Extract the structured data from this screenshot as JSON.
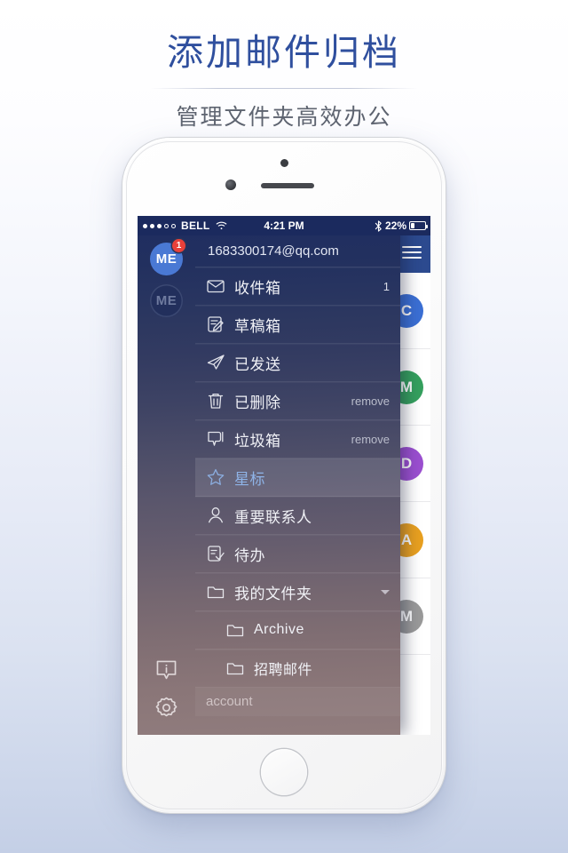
{
  "promo": {
    "title": "添加邮件归档",
    "subtitle": "管理文件夹高效办公"
  },
  "statusbar": {
    "carrier": "BELL",
    "wifi_icon": "wifi-icon",
    "time": "4:21 PM",
    "bluetooth_icon": "bluetooth-icon",
    "battery_percent": "22%",
    "battery_icon": "battery-icon",
    "signal_dots_filled": 3,
    "signal_dots_total": 5
  },
  "navbar": {
    "menu_icon": "hamburger-icon"
  },
  "rail": {
    "accounts": [
      {
        "initials": "ME",
        "badge": "1",
        "state": "active"
      },
      {
        "initials": "ME",
        "badge": "",
        "state": "inactive"
      }
    ],
    "bottom_icons": [
      {
        "name": "info-icon"
      },
      {
        "name": "gear-icon"
      }
    ]
  },
  "drawer": {
    "account_email": "1683300174@qq.com",
    "items": [
      {
        "label": "收件箱",
        "icon": "envelope-icon",
        "meta": "1",
        "meta_type": "count",
        "state": "normal"
      },
      {
        "label": "草稿箱",
        "icon": "draft-icon",
        "meta": "",
        "meta_type": "",
        "state": "normal"
      },
      {
        "label": "已发送",
        "icon": "send-icon",
        "meta": "",
        "meta_type": "",
        "state": "normal"
      },
      {
        "label": "已删除",
        "icon": "trash-icon",
        "meta": "remove",
        "meta_type": "action",
        "state": "normal"
      },
      {
        "label": "垃圾箱",
        "icon": "spam-icon",
        "meta": "remove",
        "meta_type": "action",
        "state": "normal"
      },
      {
        "label": "星标",
        "icon": "star-icon",
        "meta": "",
        "meta_type": "",
        "state": "selected"
      },
      {
        "label": "重要联系人",
        "icon": "person-icon",
        "meta": "",
        "meta_type": "",
        "state": "normal"
      },
      {
        "label": "待办",
        "icon": "todo-icon",
        "meta": "",
        "meta_type": "",
        "state": "normal"
      },
      {
        "label": "我的文件夹",
        "icon": "folder-icon",
        "meta": "",
        "meta_type": "chevron",
        "state": "normal"
      }
    ],
    "subfolders": [
      {
        "label": "Archive",
        "icon": "folder-icon"
      },
      {
        "label": "招聘邮件",
        "icon": "folder-icon"
      }
    ],
    "section_label": "account"
  },
  "maillist": {
    "rows": [
      {
        "avatar_letter": "C",
        "avatar_color": "#3b6fd4"
      },
      {
        "avatar_letter": "M",
        "avatar_color": "#35a05e"
      },
      {
        "avatar_letter": "D",
        "avatar_color": "#9b4fd0"
      },
      {
        "avatar_letter": "A",
        "avatar_color": "#e8a020"
      },
      {
        "avatar_letter": "M",
        "avatar_color": "#9a9a9a"
      }
    ]
  },
  "colors": {
    "brand_blue": "#2f4f9e",
    "navbar_blue": "#2c4a8f",
    "statusbar_blue": "#1b2a5e",
    "badge_red": "#e8403a",
    "selected_blue": "#8fb4e8"
  }
}
